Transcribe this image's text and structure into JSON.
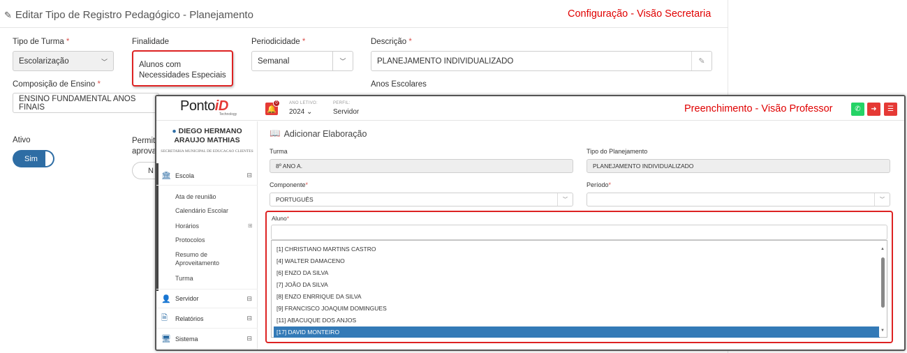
{
  "secretaria": {
    "title": "Editar Tipo de Registro Pedagógico - Planejamento",
    "note": "Configuração - Visão Secretaria",
    "tipo_turma": {
      "label": "Tipo de Turma",
      "value": "Escolarização"
    },
    "finalidade": {
      "label": "Finalidade",
      "value": "Alunos com Necessidades Especiais"
    },
    "periodicidade": {
      "label": "Periodicidade",
      "value": "Semanal"
    },
    "descricao": {
      "label": "Descrição",
      "value": "PLANEJAMENTO INDIVIDUALIZADO"
    },
    "composicao": {
      "label": "Composição de Ensino",
      "value": "ENSINO FUNDAMENTAL ANOS FINAIS"
    },
    "anos_escolares": {
      "label": "Anos Escolares"
    },
    "ativo": {
      "label": "Ativo",
      "value": "Sim"
    },
    "permite": {
      "label_line1": "Permit",
      "label_line2": "aprova",
      "value": "N"
    }
  },
  "professor": {
    "logo_main": "Ponto",
    "logo_accent": "iD",
    "logo_sub": "Technology",
    "notification_count": "0",
    "ano_letivo_label": "ANO LETIVO:",
    "ano_letivo_value": "2024",
    "perfil_label": "PERFIL:",
    "perfil_value": "Servidor",
    "note": "Preenchimento - Visão Professor",
    "colors": {
      "whatsapp": "#25d366",
      "logout": "#e53935",
      "menu": "#e53935"
    },
    "sidebar": {
      "user_name": "DIEGO HERMANO ARAUJO MATHIAS",
      "org": "SECRETARIA MUNICIPAL DE EDUCACAO CLIENTES",
      "escola": "Escola",
      "escola_items": [
        "Ata de reunião",
        "Calendário Escolar",
        "Horários",
        "Protocolos",
        "Resumo de Aproveitamento",
        "Turma"
      ],
      "servidor": "Servidor",
      "relatorios": "Relatórios",
      "sistema": "Sistema"
    },
    "form": {
      "title": "Adicionar Elaboração",
      "turma": {
        "label": "Turma",
        "value": "8º ANO A."
      },
      "tipo_planejamento": {
        "label": "Tipo do Planejamento",
        "value": "PLANEJAMENTO INDIVIDUALIZADO"
      },
      "componente": {
        "label": "Componente",
        "value": "PORTUGUÊS"
      },
      "periodo": {
        "label": "Período",
        "value": ""
      },
      "aluno": {
        "label": "Aluno",
        "options": [
          "[1] CHRISTIANO MARTINS CASTRO",
          "[4] WALTER DAMACENO",
          "[6] ENZO DA SILVA",
          "[7] JOÃO DA SILVA",
          "[8] ENZO ENRRIQUE DA SILVA",
          "[9] FRANCISCO JOAQUIM DOMINGUES",
          "[11] ABACUQUE DOS ANJOS",
          "[17] DAVID MONTEIRO"
        ],
        "selected": "[17] DAVID MONTEIRO"
      }
    }
  }
}
